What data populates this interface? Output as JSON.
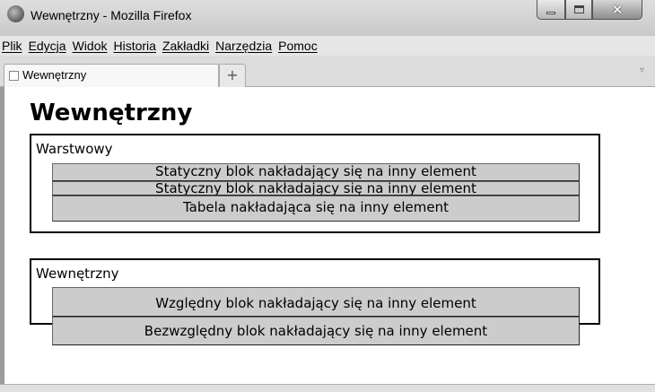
{
  "window": {
    "title": "Wewnętrzny - Mozilla Firefox"
  },
  "menu": {
    "items": [
      "Plik",
      "Edycja",
      "Widok",
      "Historia",
      "Zakładki",
      "Narzędzia",
      "Pomoc"
    ]
  },
  "tabs": {
    "active_label": "Wewnętrzny",
    "new_tab_label": "+",
    "list_glyph": "▿"
  },
  "page": {
    "heading": "Wewnętrzny",
    "section1": {
      "label": "Warstwowy",
      "blocks": [
        "Statyczny blok nakładający się na inny element",
        "Statyczny blok nakładający się na inny element",
        "Tabela nakładająca się na inny element"
      ]
    },
    "section2": {
      "label": "Wewnętrzny",
      "blocks": [
        "Względny blok nakładający się na inny element",
        "Bezwzględny blok nakładający się na inny element"
      ]
    }
  },
  "icons": {
    "app": "firefox-icon",
    "minimize": "minimize-icon",
    "maximize": "maximize-icon",
    "close": "close-icon",
    "favicon": "page-icon"
  }
}
